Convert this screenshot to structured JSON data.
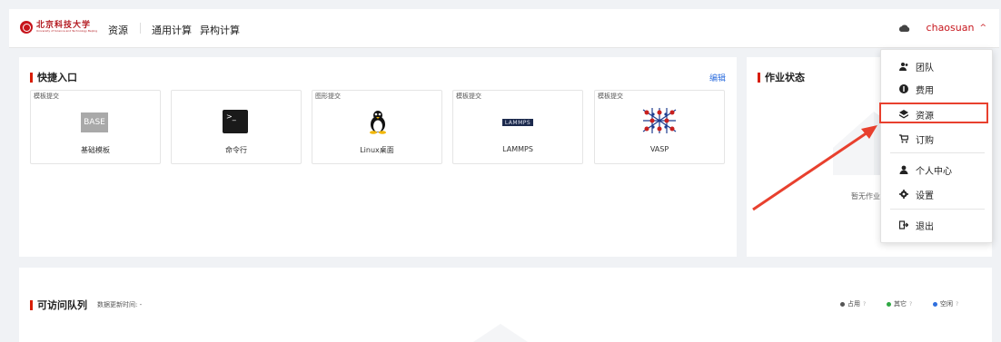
{
  "header": {
    "logo_text": "北京科技大学",
    "logo_subtext": "University of Science and Technology Beijing",
    "nav": [
      "资源",
      "通用计算",
      "异构计算"
    ],
    "cloud_icon": "cloud-icon",
    "username": "chaosuan",
    "dropdown_icon": "chevron-up-icon"
  },
  "quick_entry": {
    "title": "快捷入口",
    "edit_label": "编辑",
    "cards": [
      {
        "tag": "模板提交",
        "name": "基础模板",
        "icon": "base-template-icon",
        "icon_text": "BASE"
      },
      {
        "tag": "",
        "name": "命令行",
        "icon": "terminal-icon",
        "icon_text": ">_"
      },
      {
        "tag": "图形提交",
        "name": "Linux桌面",
        "icon": "linux-penguin-icon"
      },
      {
        "tag": "模板提交",
        "name": "LAMMPS",
        "icon": "lammps-logo-icon",
        "icon_text": "LAMMPS"
      },
      {
        "tag": "模板提交",
        "name": "VASP",
        "icon": "vasp-logo-icon"
      }
    ]
  },
  "job_status": {
    "title": "作业状态",
    "empty_text": "暂无作业"
  },
  "queues": {
    "title": "可访问队列",
    "updated_label": "数据更新时间: -",
    "legend": [
      {
        "label": "占用",
        "color": "#555555"
      },
      {
        "label": "其它",
        "color": "#2fa843"
      },
      {
        "label": "空闲",
        "color": "#2f6fde"
      }
    ]
  },
  "user_menu": {
    "items": [
      {
        "label": "团队",
        "icon": "team-icon"
      },
      {
        "label": "费用",
        "icon": "fee-icon"
      },
      {
        "label": "资源",
        "icon": "layers-icon"
      },
      {
        "label": "订购",
        "icon": "cart-icon"
      },
      {
        "label": "个人中心",
        "icon": "user-icon"
      },
      {
        "label": "设置",
        "icon": "gear-icon"
      },
      {
        "label": "退出",
        "icon": "logout-icon"
      }
    ],
    "highlight_color": "#e8402e"
  }
}
